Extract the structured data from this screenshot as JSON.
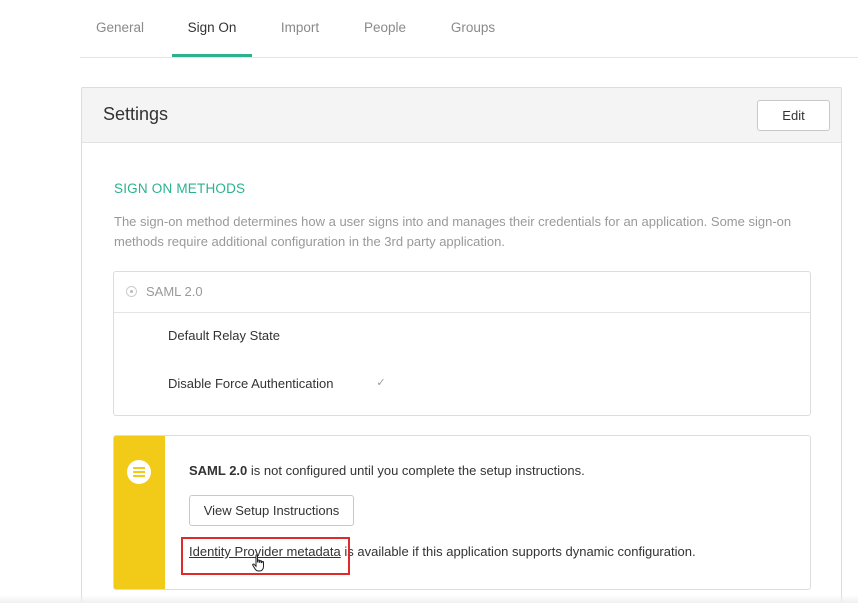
{
  "tabs": [
    {
      "label": "General"
    },
    {
      "label": "Sign On"
    },
    {
      "label": "Import"
    },
    {
      "label": "People"
    },
    {
      "label": "Groups"
    }
  ],
  "active_tab": "Sign On",
  "settings": {
    "title": "Settings",
    "edit_label": "Edit"
  },
  "sign_on": {
    "section_title": "SIGN ON METHODS",
    "description": "The sign-on method determines how a user signs into and manages their credentials for an application. Some sign-on methods require additional configuration in the 3rd party application."
  },
  "saml": {
    "label": "SAML 2.0",
    "relay_state_label": "Default Relay State",
    "force_auth_label": "Disable Force Authentication",
    "force_auth_checked": true
  },
  "notice": {
    "strong": "SAML 2.0",
    "text_rest": " is not configured until you complete the setup instructions.",
    "setup_button": "View Setup Instructions",
    "metadata_link": "Identity Provider metadata",
    "metadata_rest": " is available if this application supports dynamic configuration."
  },
  "colors": {
    "accent": "#2cb18f",
    "notice_bar": "#f2ca18",
    "highlight": "#e02a2a"
  },
  "icons": {
    "notice": "list-icon",
    "radio": "radio-icon",
    "checkbox": "checkmark-icon",
    "cursor": "hand-pointer-icon"
  }
}
